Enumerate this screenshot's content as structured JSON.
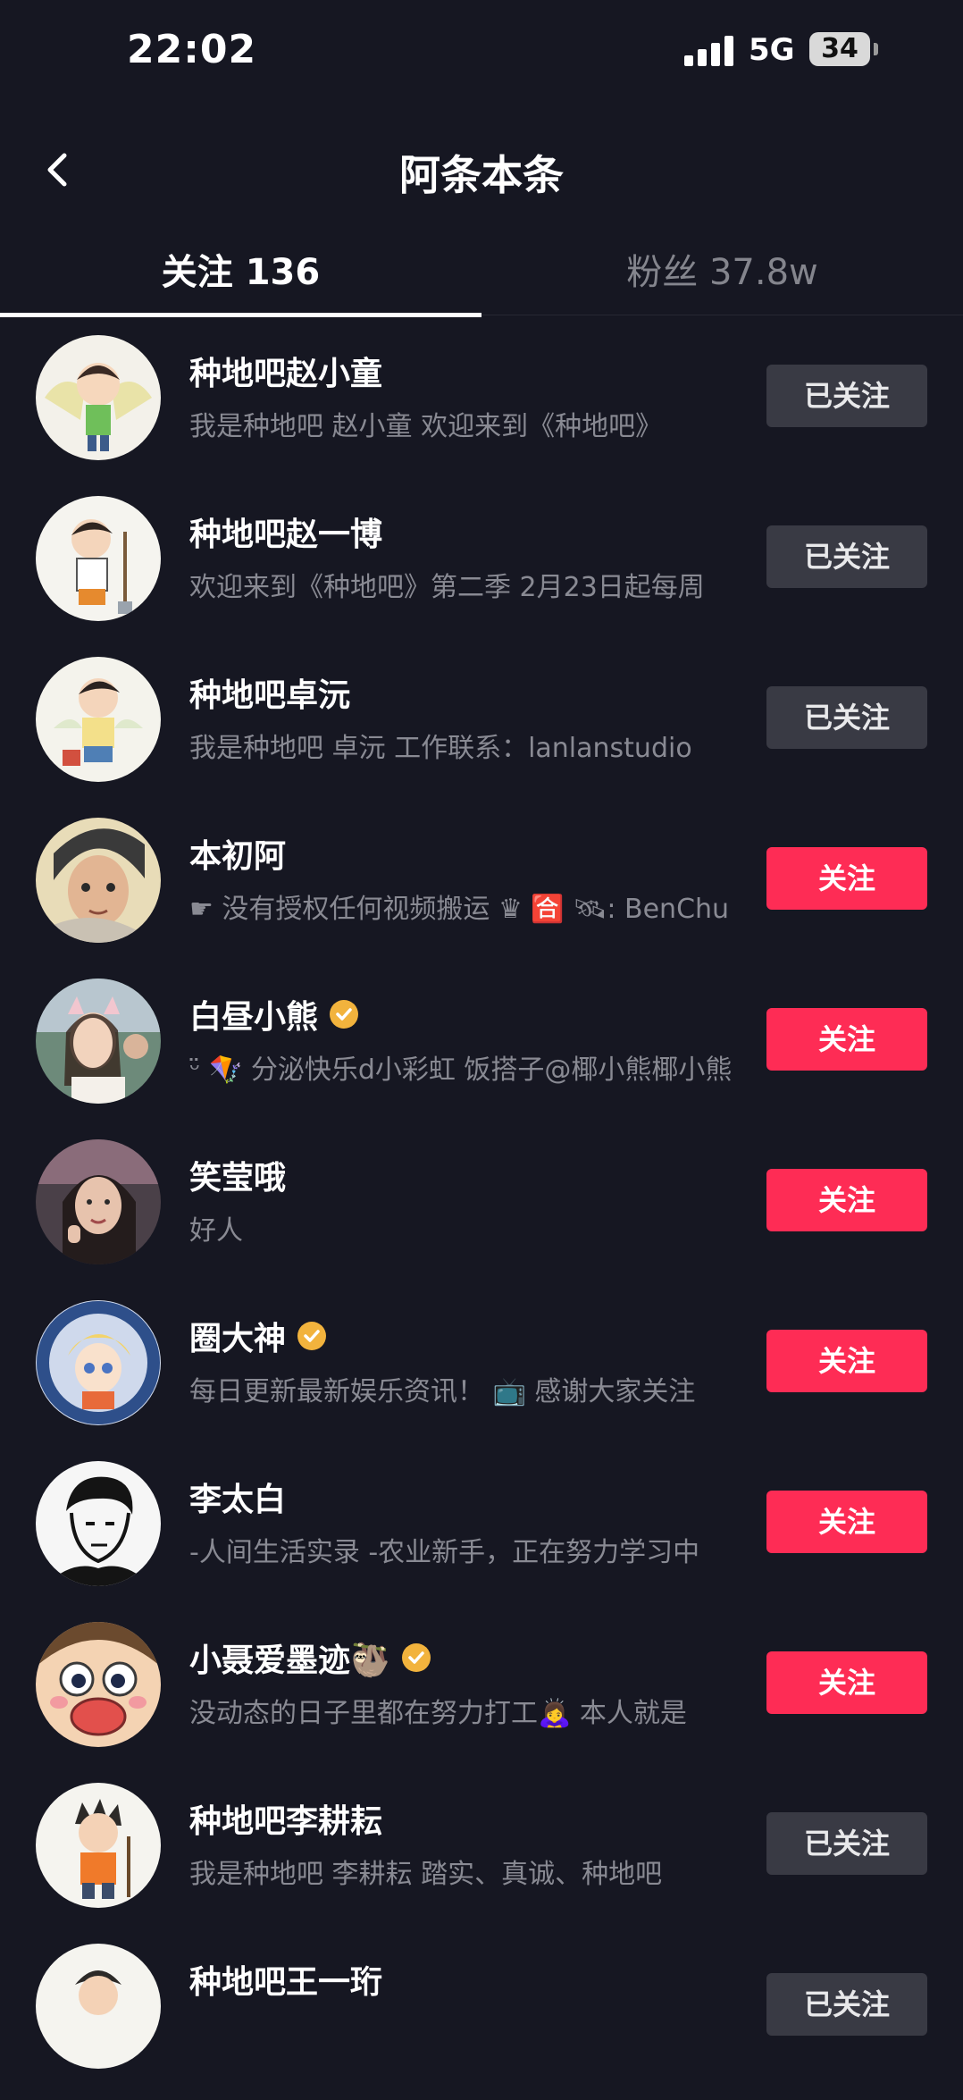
{
  "status": {
    "time": "22:02",
    "network": "5G",
    "battery": "34"
  },
  "header": {
    "title": "阿条本条"
  },
  "tabs": [
    {
      "label": "关注 136"
    },
    {
      "label": "粉丝 37.8w"
    }
  ],
  "users": [
    {
      "name": "种地吧赵小童",
      "desc": "我是种地吧 赵小童  欢迎来到《种地吧》",
      "button": "已关注",
      "verified": false
    },
    {
      "name": "种地吧赵一博",
      "desc": "欢迎来到《种地吧》第二季 2月23日起每周",
      "button": "已关注",
      "verified": false
    },
    {
      "name": "种地吧卓沅",
      "desc": "我是种地吧 卓沅  工作联系：lanlanstudio",
      "button": "已关注",
      "verified": false
    },
    {
      "name": "本初阿",
      "desc": "☛ 没有授权任何视频搬运 ♛ 🈴 🛰: BenChu",
      "button": "关注",
      "verified": false
    },
    {
      "name": "白昼小熊",
      "desc": "ᵕ̈ 🪁 分泌快乐d小彩虹 饭搭子@椰小熊椰小熊",
      "button": "关注",
      "verified": true
    },
    {
      "name": "笑莹哦",
      "desc": "好人",
      "button": "关注",
      "verified": false
    },
    {
      "name": "圈大神",
      "desc": "每日更新最新娱乐资讯！ 📺 感谢大家关注",
      "button": "关注",
      "verified": true
    },
    {
      "name": "李太白",
      "desc": "-人间生活实录  -农业新手，正在努力学习中",
      "button": "关注",
      "verified": false
    },
    {
      "name": "小聂爱墨迹🦥",
      "desc": "没动态的日子里都在努力打工🙇‍♀️ 本人就是",
      "button": "关注",
      "verified": true
    },
    {
      "name": "种地吧李耕耘",
      "desc": "我是种地吧 李耕耘  踏实、真诚、种地吧",
      "button": "已关注",
      "verified": false
    },
    {
      "name": "种地吧王一珩",
      "desc": "",
      "button": "已关注",
      "verified": false
    }
  ],
  "icons": {
    "back": "back-chevron-icon",
    "verified": "verified-badge-icon",
    "signal": "signal-bars-icon",
    "battery": "battery-icon"
  },
  "colors": {
    "background": "#161722",
    "follow": "#fe2c55",
    "following": "#393a44",
    "verified": "#f2b33d"
  }
}
